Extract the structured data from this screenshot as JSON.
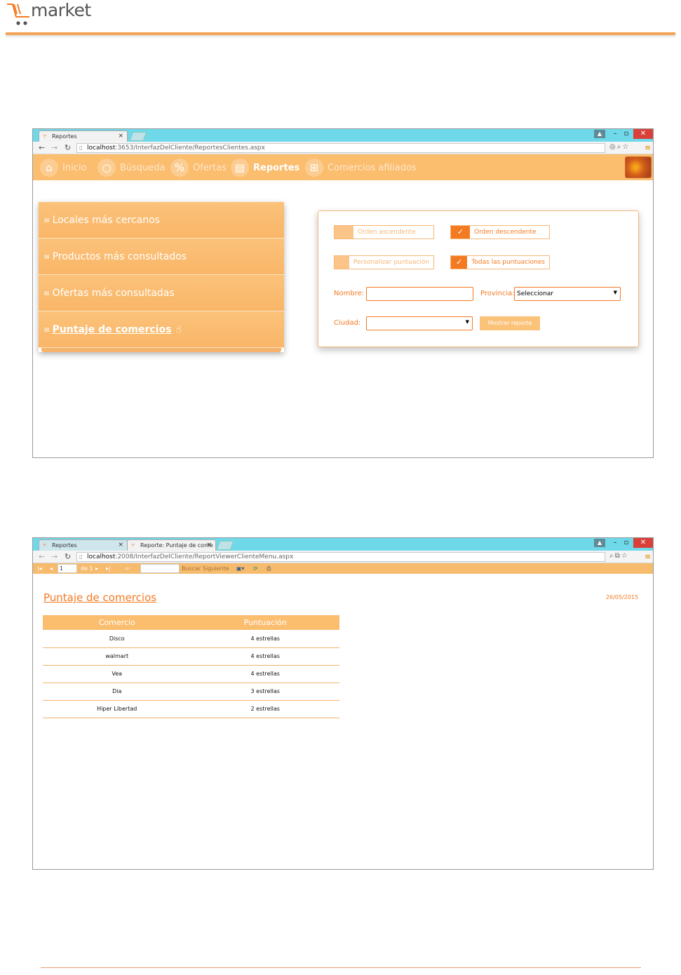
{
  "doc": {
    "brand": "market"
  },
  "shot1": {
    "tab": {
      "title": "Reportes",
      "close": "×"
    },
    "url": {
      "host": "localhost",
      "path": ":3653/InterfazDelCliente/ReportesClientes.aspx"
    },
    "nav": [
      {
        "label": "Inicio",
        "icon": "home-icon"
      },
      {
        "label": "Búsqueda",
        "icon": "search-icon"
      },
      {
        "label": "Ofertas",
        "icon": "percent-icon"
      },
      {
        "label": "Reportes",
        "icon": "clipboard-icon"
      },
      {
        "label": "Comercios afiliados",
        "icon": "cart-icon"
      }
    ],
    "menu": [
      "Locales más cercanos",
      "Productos más consultados",
      "Ofertas más consultadas",
      "Puntaje de comercios"
    ],
    "filters": {
      "asc": "Orden ascendente",
      "desc": "Orden descendente",
      "custom": "Personalizar puntuación",
      "all": "Todas las puntuaciones",
      "nombre_label": "Nombre:",
      "provincia_label": "Provincia:",
      "provincia_value": "Seleccionar",
      "ciudad_label": "Ciudad:",
      "show_button": "Mostrar reporte"
    }
  },
  "shot2": {
    "tab1": "Reportes",
    "tab2": "Reporte: Puntaje de come",
    "url": {
      "host": "localhost",
      "path": ":2008/InterfazDelCliente/ReportViewerClienteMenu.aspx"
    },
    "toolbar": {
      "page": "1",
      "of": "de 1",
      "find": "Buscar",
      "next": "Siguiente"
    },
    "title": "Puntaje de comercios",
    "date": "26/05/2015",
    "columns": [
      "Comercio",
      "Puntuación"
    ],
    "rows": [
      [
        "Disco",
        "4 estrellas"
      ],
      [
        "walmart",
        "4 estrellas"
      ],
      [
        "Vea",
        "4 estrellas"
      ],
      [
        "Dia",
        "3 estrellas"
      ],
      [
        "Hiper Libertad",
        "2 estrellas"
      ]
    ]
  },
  "colors": {
    "accent": "#f47a22",
    "nav": "#fbbd6e",
    "chrome": "#6fd9ea"
  }
}
